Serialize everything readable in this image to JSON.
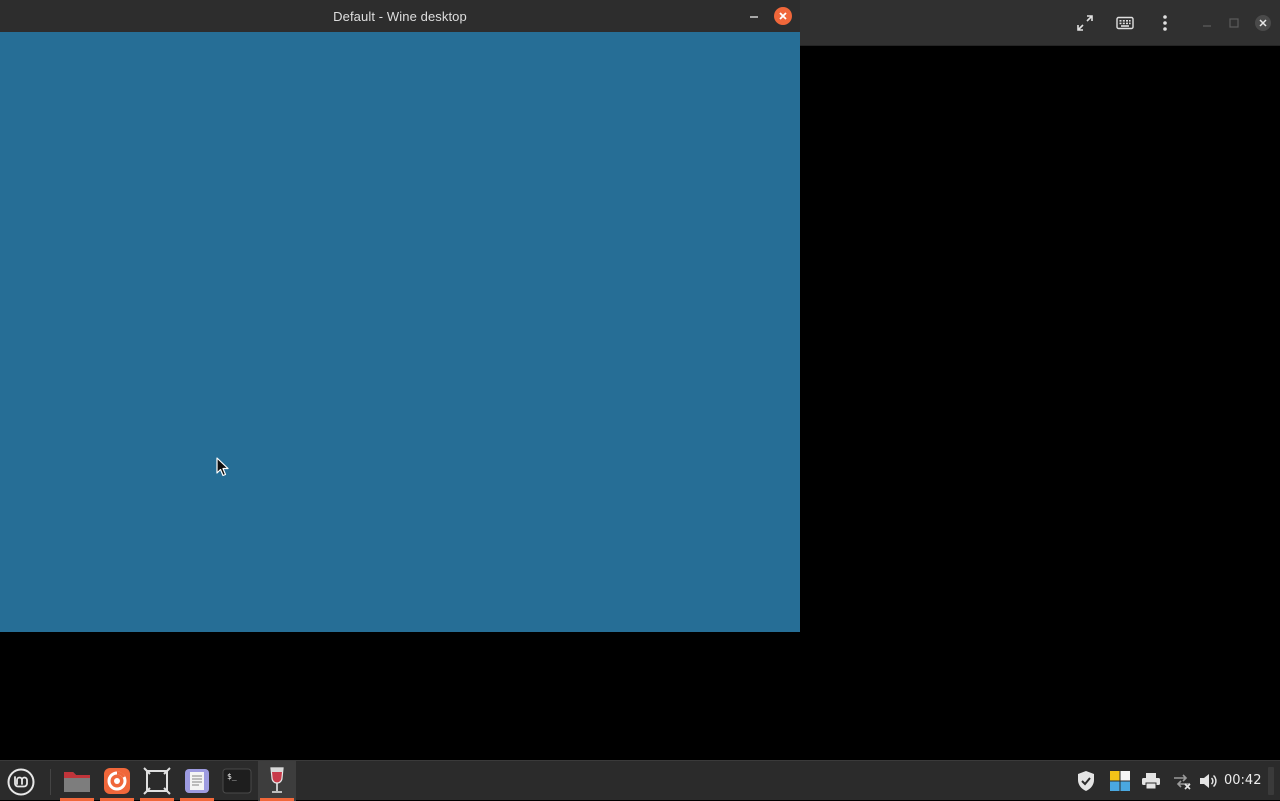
{
  "wine_window": {
    "title": "Default - Wine desktop",
    "desktop_color": "#266e96"
  },
  "background_window": {
    "controls": [
      "fullscreen-icon",
      "keyboard-icon",
      "more-options-icon",
      "minimize-icon",
      "maximize-icon",
      "close-icon"
    ]
  },
  "taskbar": {
    "launchers": [
      {
        "name": "files",
        "icon": "folder-icon",
        "running": true
      },
      {
        "name": "firefox",
        "icon": "firefox-icon",
        "running": true
      },
      {
        "name": "screenshot",
        "icon": "frame-icon",
        "running": true
      },
      {
        "name": "text-editor",
        "icon": "text-editor-icon",
        "running": true
      },
      {
        "name": "terminal",
        "icon": "terminal-icon",
        "running": false
      },
      {
        "name": "wine",
        "icon": "wine-glass-icon",
        "running": true
      }
    ],
    "tray": [
      "shield-icon",
      "color-picker-icon",
      "printer-icon",
      "network-icon",
      "volume-icon"
    ],
    "clock": "00:42"
  },
  "colors": {
    "accent": "#f0673a",
    "taskbar": "#2b2b2b",
    "titlebar": "#2d2d2d"
  }
}
